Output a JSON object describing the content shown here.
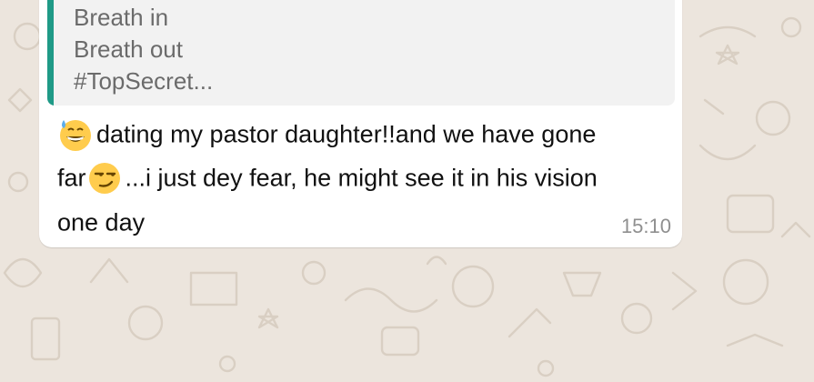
{
  "quoted_message": {
    "lines": [
      "Breath in",
      "Breath out",
      "#TopSecret..."
    ]
  },
  "message": {
    "line1": "dating my pastor daughter!!and we have gone",
    "line2_a": "far",
    "line2_b": "...i just dey fear, he might see it in his vision",
    "line3": "one day",
    "emoji1": "grinning-sweat-emoji",
    "emoji2": "smirking-face-emoji",
    "time": "15:10"
  },
  "colors": {
    "quote_bar": "#1f9a87",
    "bubble": "#ffffff",
    "chat_background": "#ece5dd"
  }
}
